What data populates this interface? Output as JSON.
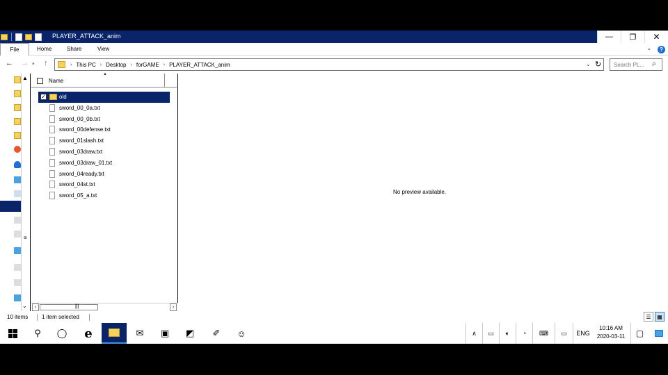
{
  "window": {
    "title": "PLAYER_ATTACK_anim",
    "minimize": "—",
    "maximize": "❐",
    "close": "✕"
  },
  "ribbon": {
    "tabs": [
      "File",
      "Home",
      "Share",
      "View"
    ],
    "expand_icon": "chevron-down-icon",
    "help_icon": "?"
  },
  "address": {
    "crumbs": [
      "This PC",
      "Desktop",
      "forGAME",
      "PLAYER_ATTACK_anim"
    ],
    "separator": "›",
    "search_placeholder": "Search PL..."
  },
  "filelist": {
    "column_name": "Name",
    "items": [
      {
        "name": "old",
        "type": "folder",
        "selected": true
      },
      {
        "name": "sword_00_0a.txt",
        "type": "file"
      },
      {
        "name": "sword_00_0b.txt",
        "type": "file"
      },
      {
        "name": "sword_00defense.txt",
        "type": "file"
      },
      {
        "name": "sword_01slash.txt",
        "type": "file"
      },
      {
        "name": "sword_03draw.txt",
        "type": "file"
      },
      {
        "name": "sword_03draw_01.txt",
        "type": "file"
      },
      {
        "name": "sword_04ready.txt",
        "type": "file"
      },
      {
        "name": "sword_04st.txt",
        "type": "file"
      },
      {
        "name": "sword_05_a.txt",
        "type": "file"
      }
    ]
  },
  "preview": {
    "message": "No preview available."
  },
  "status": {
    "item_count": "10 items",
    "selection": "1 item selected"
  },
  "taskbar": {
    "edge_glyph": "e",
    "tray_language": "ENG",
    "clock_time": "10:16 AM",
    "clock_date": "2020-03-11"
  },
  "colors": {
    "selection": "#0a246a",
    "titlebar": "#0a246a",
    "folder": "#f4d25c",
    "accent": "#1e6fd0"
  }
}
